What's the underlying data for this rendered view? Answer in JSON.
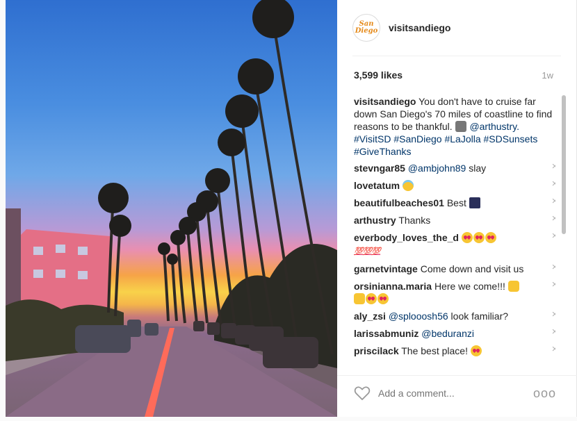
{
  "post": {
    "account": {
      "username": "visitsandiego",
      "avatar_text": "San Diego"
    },
    "likes": "3,599 likes",
    "age": "1w",
    "caption": {
      "username": "visitsandiego",
      "text": "You don't have to cruise far down San Diego's 70 miles of coastline to find reasons to be thankful.",
      "tags": "@arthustry. #VisitSD #SanDiego #LaJolla #SDSunsets #GiveThanks",
      "emoji": "camera"
    },
    "comments": [
      {
        "username": "stevngar85",
        "mention": "@ambjohn89",
        "text": " slay",
        "emoji": [],
        "trail": ""
      },
      {
        "username": "lovetatum",
        "mention": "",
        "text": "",
        "emoji": [
          "angel"
        ],
        "trail": ""
      },
      {
        "username": "beautifulbeaches01",
        "mention": "",
        "text": "Best",
        "emoji": [
          "picture"
        ],
        "trail": ""
      },
      {
        "username": "arthustry",
        "mention": "",
        "text": "Thanks",
        "emoji": [],
        "trail": ""
      },
      {
        "username": "everbody_loves_the_d",
        "mention": "",
        "text": "",
        "emoji": [
          "heart-eyes",
          "heart-eyes",
          "heart-eyes"
        ],
        "trail": "💯💯💯"
      },
      {
        "username": "garnetvintage",
        "mention": "",
        "text": "Come down and visit us",
        "emoji": [],
        "trail": ""
      },
      {
        "username": "orsinianna.maria",
        "mention": "",
        "text": "Here we come!!!",
        "emoji": [
          "raised-hands",
          "raised-hands",
          "heart-eyes",
          "heart-eyes"
        ],
        "trail": ""
      },
      {
        "username": "aly_zsi",
        "mention": "@splooosh56",
        "text": " look familiar?",
        "emoji": [],
        "trail": ""
      },
      {
        "username": "larissabmuniz",
        "mention": "@beduranzi",
        "text": "",
        "emoji": [],
        "trail": ""
      },
      {
        "username": "priscilack",
        "mention": "",
        "text": "The best place!",
        "emoji": [
          "heart-eyes"
        ],
        "trail": ""
      }
    ],
    "add_comment_placeholder": "Add a comment...",
    "more_label": "ooo",
    "delete_label": "×"
  },
  "icons": {
    "heart": "heart-outline-icon",
    "more": "more-options-icon",
    "delete": "close-icon"
  },
  "colors": {
    "link": "#003569",
    "muted": "#999999",
    "accent": "#e58a1a"
  }
}
